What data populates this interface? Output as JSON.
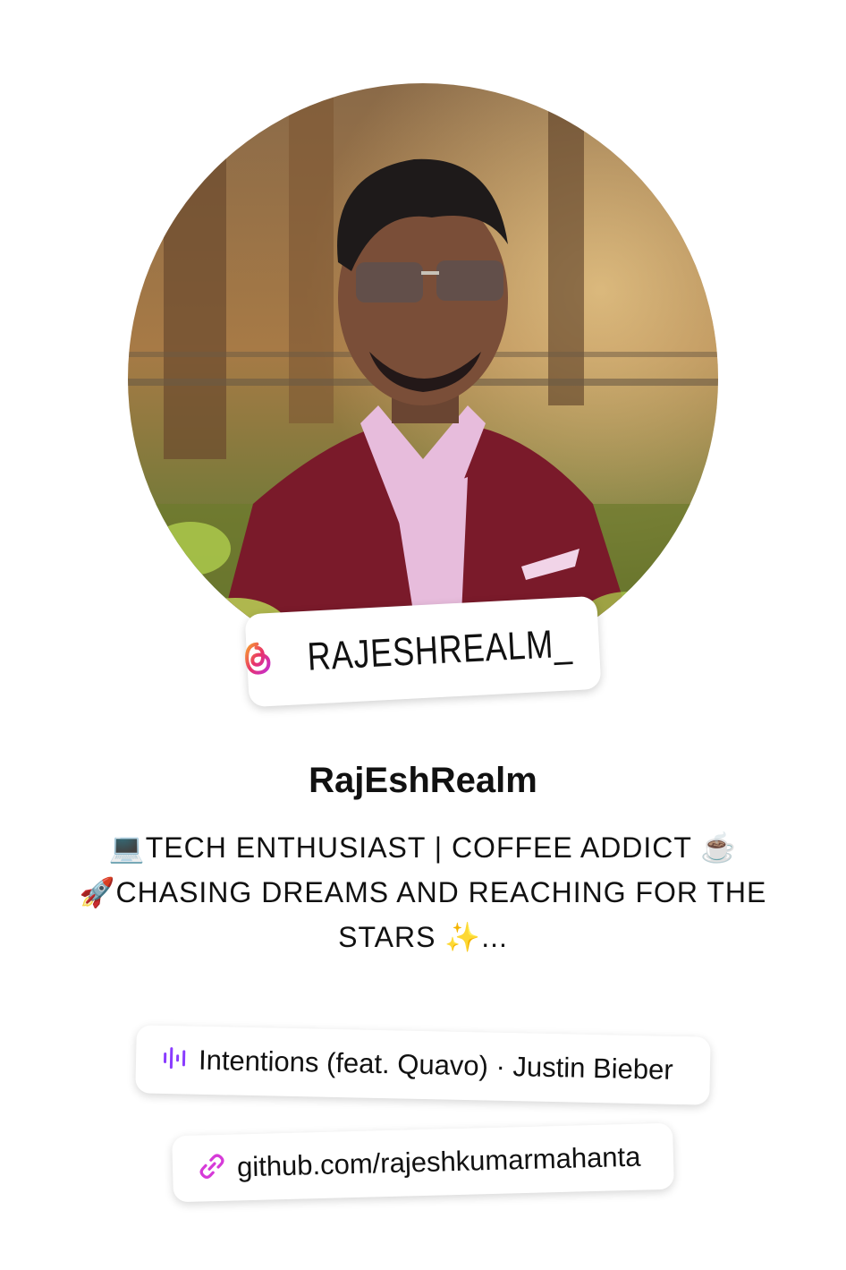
{
  "profile": {
    "handle": "RAJESHREALM_",
    "handle_icon": "threads-icon",
    "display_name": "RajEshRealm",
    "avatar": "profile-photo",
    "bio_line1": "💻TECH ENTHUSIAST | COFFEE ADDICT ☕",
    "bio_line2": "🚀CHASING DREAMS AND REACHING FOR THE",
    "bio_line3": "STARS ✨..."
  },
  "music": {
    "icon": "music-bars-icon",
    "text": "Intentions (feat. Quavo) · Justin Bieber"
  },
  "link": {
    "icon": "link-icon",
    "text": "github.com/rajeshkumarmahanta"
  },
  "colors": {
    "music_accent": "#8a3cff",
    "link_accent": "#d63ad8",
    "threads_gradient_start": "#f7a02c",
    "threads_gradient_end": "#c42fd2"
  }
}
